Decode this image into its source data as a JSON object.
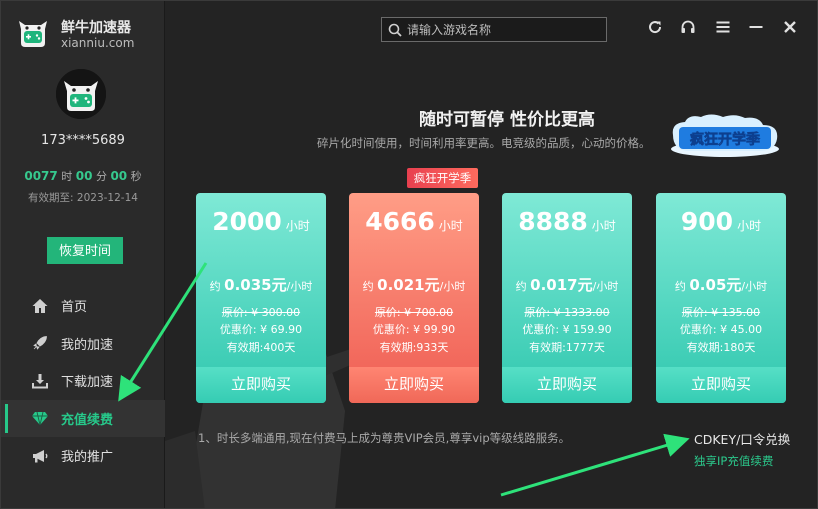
{
  "brand": {
    "name": "鲜牛加速器",
    "url": "xianniu.com"
  },
  "user": {
    "phone": "173****5689",
    "time_left": {
      "hours": "0077",
      "hours_unit": "时",
      "minutes": "00",
      "minutes_unit": "分",
      "seconds": "00",
      "seconds_unit": "秒"
    },
    "expiry": "有效期至: 2023-12-14"
  },
  "restore_button": "恢复时间",
  "nav": [
    {
      "label": "首页",
      "icon": "home-icon"
    },
    {
      "label": "我的加速",
      "icon": "rocket-icon"
    },
    {
      "label": "下载加速",
      "icon": "download-icon"
    },
    {
      "label": "充值续费",
      "icon": "diamond-icon",
      "active": true
    },
    {
      "label": "我的推广",
      "icon": "megaphone-icon"
    }
  ],
  "search": {
    "placeholder": "请输入游戏名称"
  },
  "window_controls": [
    "refresh-icon",
    "headset-icon",
    "menu-icon",
    "minimize-icon",
    "close-icon"
  ],
  "promo": {
    "headline": "随时可暂停 性价比更高",
    "subline": "碎片化时间使用，时间利用率更高。电竞级的品质，心动的价格。",
    "badge_text": "疯狂开学季"
  },
  "hot_tag": "疯狂开学季",
  "plans": [
    {
      "hours": "2000",
      "unit": "小时",
      "rate_prefix": "约",
      "rate": "0.035元",
      "rate_unit": "/小时",
      "original": "原价: ¥ 300.00",
      "discount": "优惠价: ¥ 69.90",
      "validity": "有效期:400天",
      "buy": "立即购买",
      "style": "teal"
    },
    {
      "hours": "4666",
      "unit": "小时",
      "rate_prefix": "约",
      "rate": "0.021元",
      "rate_unit": "/小时",
      "original": "原价: ¥ 700.00",
      "discount": "优惠价: ¥ 99.90",
      "validity": "有效期:933天",
      "buy": "立即购买",
      "style": "coral"
    },
    {
      "hours": "8888",
      "unit": "小时",
      "rate_prefix": "约",
      "rate": "0.017元",
      "rate_unit": "/小时",
      "original": "原价: ¥ 1333.00",
      "discount": "优惠价: ¥ 159.90",
      "validity": "有效期:1777天",
      "buy": "立即购买",
      "style": "teal"
    },
    {
      "hours": "900",
      "unit": "小时",
      "rate_prefix": "约",
      "rate": "0.05元",
      "rate_unit": "/小时",
      "original": "原价: ¥ 135.00",
      "discount": "优惠价: ¥ 45.00",
      "validity": "有效期:180天",
      "buy": "立即购买",
      "style": "teal"
    }
  ],
  "note": "1、时长多端通用,现在付费马上成为尊贵VIP会员,尊享vip等级线路服务。",
  "cdkey": "CDKEY/口令兑换",
  "vip_link": "独享IP充值续费",
  "colors": {
    "accent": "#27c88a",
    "teal_card": "#2fc7ae",
    "coral_card": "#ef5c52",
    "hot_tag": "#e8404f"
  }
}
